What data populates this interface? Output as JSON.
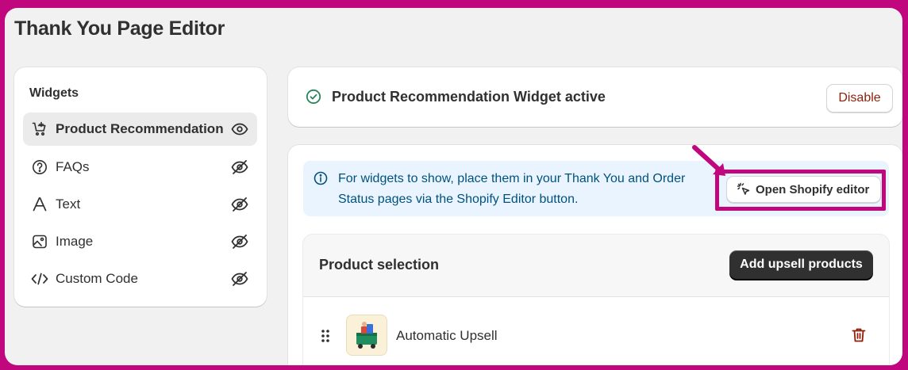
{
  "page": {
    "title": "Thank You Page Editor"
  },
  "sidebar": {
    "heading": "Widgets",
    "items": [
      {
        "label": "Product Recommendation",
        "icon": "cart-plus-icon",
        "visibility": "visible",
        "active": true
      },
      {
        "label": "FAQs",
        "icon": "question-circle-icon",
        "visibility": "hidden",
        "active": false
      },
      {
        "label": "Text",
        "icon": "text-icon",
        "visibility": "hidden",
        "active": false
      },
      {
        "label": "Image",
        "icon": "image-icon",
        "visibility": "hidden",
        "active": false
      },
      {
        "label": "Custom Code",
        "icon": "code-icon",
        "visibility": "hidden",
        "active": false
      }
    ]
  },
  "status": {
    "text": "Product Recommendation Widget active",
    "disable_label": "Disable"
  },
  "banner": {
    "text": "For widgets to show, place them in your Thank You and Order Status pages via the Shopify Editor button.",
    "button_label": "Open Shopify editor"
  },
  "product_selection": {
    "title": "Product selection",
    "add_button_label": "Add upsell products",
    "products": [
      {
        "name": "Automatic Upsell"
      }
    ]
  },
  "colors": {
    "highlight": "#c0077d",
    "success": "#29845a",
    "info_text": "#00527c",
    "critical": "#8e1f0b"
  }
}
